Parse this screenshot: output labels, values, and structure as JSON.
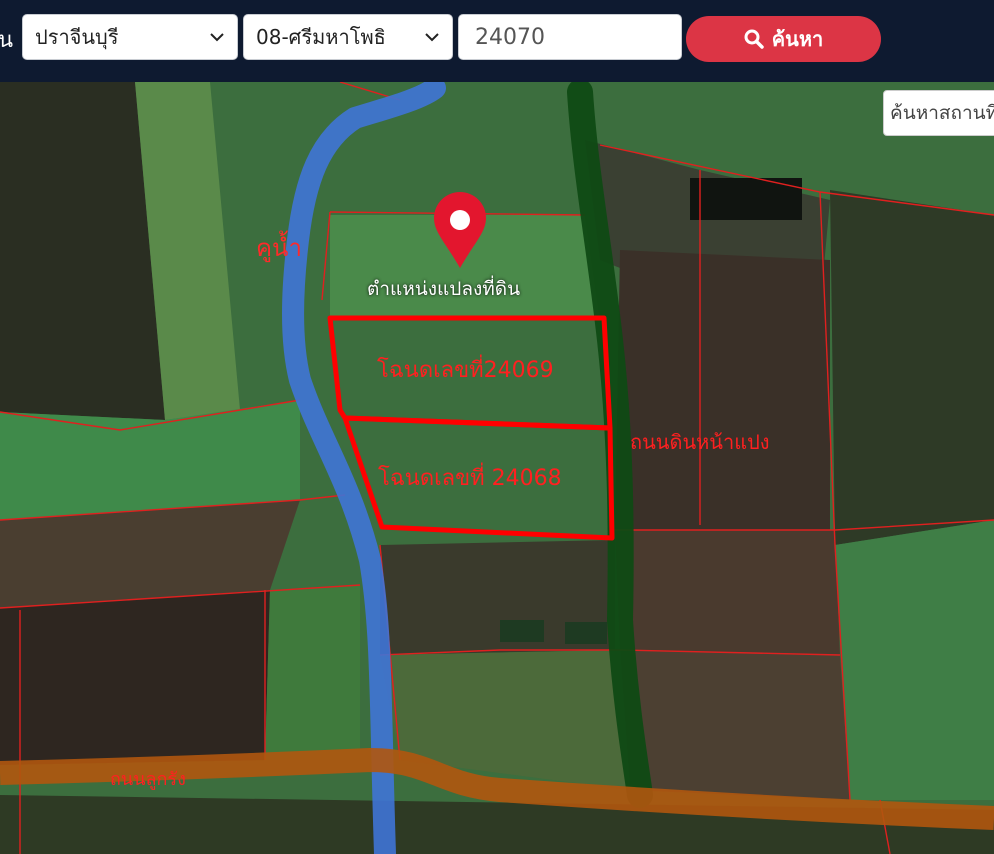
{
  "toolbar": {
    "prefix_label": "น",
    "province_value": "ปราจีนบุรี",
    "district_value": "08-ศรีมหาโพธิ",
    "parcel_value": "24070",
    "search_button_label": "ค้นหา"
  },
  "map": {
    "place_search_placeholder": "ค้นหาสถานที่",
    "marker_label": "ตำแหน่งแปลงที่ดิน",
    "canal_label": "คูน้ำ",
    "deed_label_1": "โฉนดเลขที่24069",
    "deed_label_2": "โฉนดเลขที่ 24068",
    "road_label_east": "ถนนดินหน้าแปง",
    "road_label_south": "ถนนลูกรัง"
  },
  "colors": {
    "topbar_bg": "#0e1a30",
    "search_button": "#dc3545",
    "parcel_outline": "#ff0000",
    "canal": "#3f74d6",
    "dirt_road": "#0f4a14",
    "laterite_road": "#b0560e"
  },
  "icons": [
    "chevron-down-icon",
    "search-icon",
    "location-pin-icon"
  ]
}
